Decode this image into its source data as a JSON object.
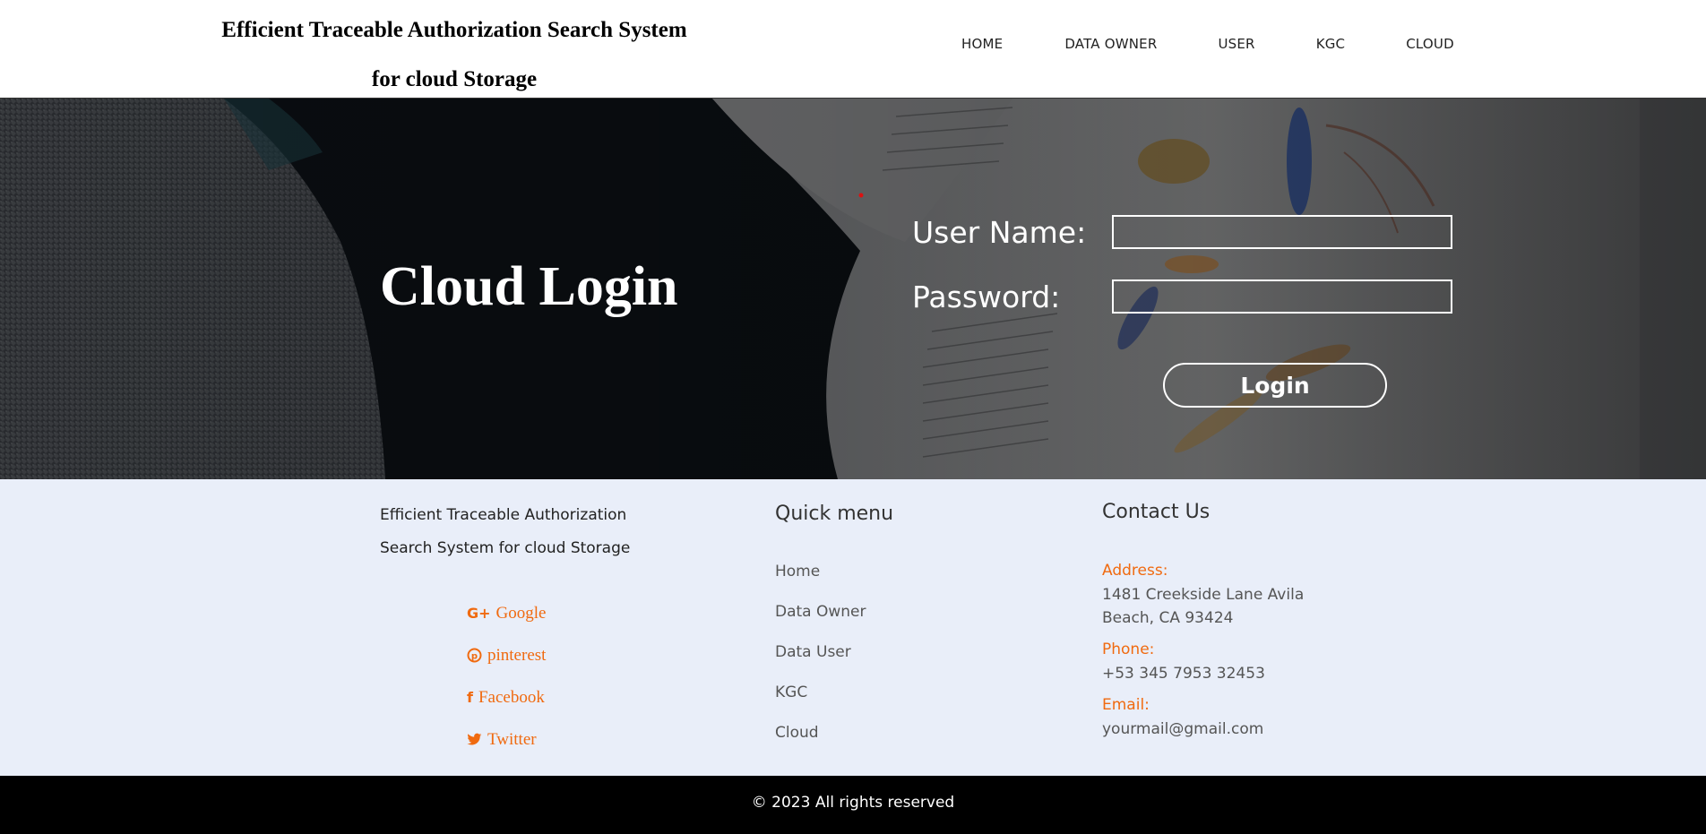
{
  "header": {
    "title_line1": "Efficient Traceable Authorization Search System",
    "title_line2": "for cloud Storage",
    "nav": [
      "HOME",
      "DATA OWNER",
      "USER",
      "KGC",
      "CLOUD"
    ]
  },
  "hero": {
    "title": "Cloud Login",
    "username_label": "User Name:",
    "password_label": "Password:",
    "username_value": "",
    "password_value": "",
    "login_button": "Login"
  },
  "footer": {
    "about_line1": "Efficient Traceable Authorization",
    "about_line2": "Search System for cloud Storage",
    "social": [
      {
        "icon": "google-plus-icon",
        "label": "Google"
      },
      {
        "icon": "pinterest-icon",
        "label": "pinterest"
      },
      {
        "icon": "facebook-icon",
        "label": "Facebook"
      },
      {
        "icon": "twitter-icon",
        "label": "Twitter"
      }
    ],
    "quick_menu_title": "Quick menu",
    "quick_menu": [
      "Home",
      "Data Owner",
      "Data User",
      "KGC",
      "Cloud"
    ],
    "contact_title": "Contact Us",
    "address_label": "Address:",
    "address_line1": "1481 Creekside Lane Avila",
    "address_line2": "Beach, CA 93424",
    "phone_label": "Phone:",
    "phone": "+53 345 7953 32453",
    "email_label": "Email:",
    "email": "yourmail@gmail.com"
  },
  "bottom": {
    "copyright": "© 2023 All rights reserved"
  },
  "colors": {
    "accent": "#f06a10",
    "footer_bg": "#e9eef9",
    "bottom_bg": "#000000"
  }
}
